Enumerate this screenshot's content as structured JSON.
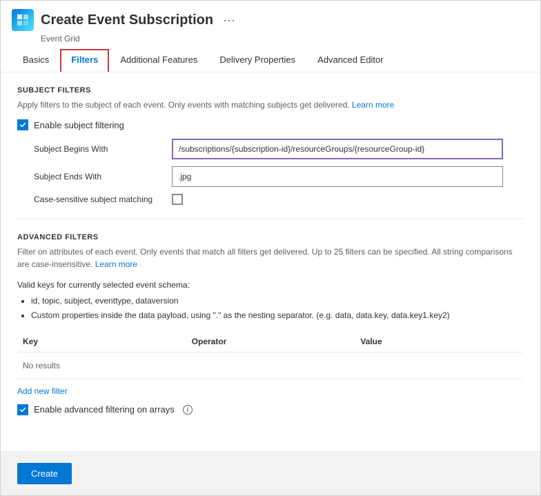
{
  "window": {
    "title": "Create Event Subscription",
    "subtitle": "Event Grid",
    "more_label": "···"
  },
  "tabs": [
    {
      "id": "basics",
      "label": "Basics",
      "active": false
    },
    {
      "id": "filters",
      "label": "Filters",
      "active": true
    },
    {
      "id": "additional",
      "label": "Additional Features",
      "active": false
    },
    {
      "id": "delivery",
      "label": "Delivery Properties",
      "active": false
    },
    {
      "id": "advanced",
      "label": "Advanced Editor",
      "active": false
    }
  ],
  "subject_filters": {
    "section_title": "SUBJECT FILTERS",
    "description": "Apply filters to the subject of each event. Only events with matching subjects get delivered.",
    "learn_more_label": "Learn more",
    "enable_label": "Enable subject filtering",
    "enable_checked": true,
    "subject_begins_with_label": "Subject Begins With",
    "subject_begins_with_value": "/subscriptions/{subscription-id}/resourceGroups/{resourceGroup-id}",
    "subject_ends_with_label": "Subject Ends With",
    "subject_ends_with_value": ".jpg",
    "case_sensitive_label": "Case-sensitive subject matching",
    "case_sensitive_checked": false
  },
  "advanced_filters": {
    "section_title": "ADVANCED FILTERS",
    "description": "Filter on attributes of each event. Only events that match all filters get delivered. Up to 25 filters can be specified. All string comparisons are case-insensitive.",
    "learn_more_label": "Learn more",
    "valid_keys_label": "Valid keys for currently selected event schema:",
    "valid_keys_items": [
      "id, topic, subject, eventtype, dataversion",
      "Custom properties inside the data payload, using \".\" as the nesting separator. (e.g. data, data.key, data.key1.key2)"
    ],
    "table_columns": [
      "Key",
      "Operator",
      "Value"
    ],
    "no_results_label": "No results",
    "add_filter_label": "Add new filter",
    "enable_arrays_label": "Enable advanced filtering on arrays",
    "enable_arrays_checked": true
  },
  "footer": {
    "create_label": "Create"
  },
  "icons": {
    "check": "✓",
    "info": "i",
    "more": "···"
  }
}
